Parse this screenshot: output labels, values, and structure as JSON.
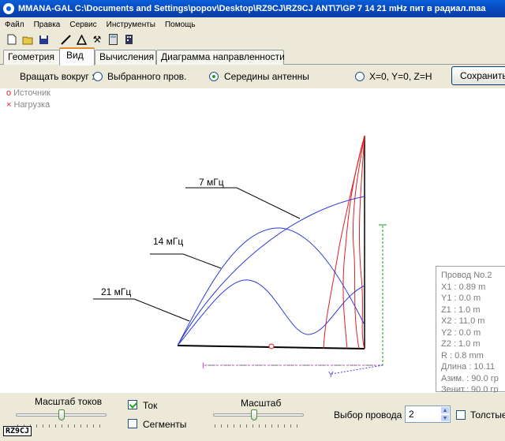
{
  "window": {
    "title": "MMANA-GAL C:\\Documents and Settings\\popov\\Desktop\\RZ9CJ\\RZ9CJ ANT\\7\\GP  7  14  21  mHz  пит в радиал.maa"
  },
  "menu": [
    "Файл",
    "Правка",
    "Сервис",
    "Инструменты",
    "Помощь"
  ],
  "toolbar": {
    "icons": [
      "new-file-icon",
      "open-folder-icon",
      "save-disk-icon",
      "line-tool-icon",
      "triangle-tool-icon",
      "tools-icon",
      "calculator-icon",
      "building-icon"
    ]
  },
  "tabs": [
    {
      "label": "Геометрия",
      "active": false
    },
    {
      "label": "Вид",
      "active": true
    },
    {
      "label": "Вычисления",
      "active": false
    },
    {
      "label": "Диаграмма направленности",
      "active": false
    }
  ],
  "rotate": {
    "label": "Вращать вокруг :",
    "options": [
      {
        "label": "Выбранного пров.",
        "selected": false
      },
      {
        "label": "Середины антенны",
        "selected": true
      },
      {
        "label": "X=0, Y=0, Z=H",
        "selected": false
      }
    ],
    "save_label": "Сохранить"
  },
  "legend": {
    "source": "Источник",
    "load": "Нагрузка",
    "source_marker": "o",
    "load_marker": "×"
  },
  "plot": {
    "labels": [
      "7 мГц",
      "14 мГц",
      "21 мГц"
    ],
    "colors": {
      "current": "#2a3ad8",
      "wire": "#000000",
      "vertical": "#e02020",
      "axis_x": "#e040e0",
      "axis_y": "#1a9a1a",
      "axis_z": "#4a4ae0"
    },
    "axis_markers": [
      "I",
      "Y"
    ]
  },
  "wire_info": {
    "title": "Провод No.2",
    "rows": [
      "X1   :  0.89 m",
      "Y1   :  0.0 m",
      "Z1   :  1.0 m",
      "X2   :  11.0 m",
      "Y2   :  0.0 m",
      "Z2   :  1.0 m",
      "R    :  0.8 mm",
      "Длина  :  10.11",
      "Азим.  :  90.0 гр",
      "Зенит.:  90.0 гр"
    ]
  },
  "bottom": {
    "current_scale_label": "Масштаб токов",
    "current_scale_level": 0.5,
    "scale_label": "Масштаб",
    "scale_level": 0.45,
    "current_checkbox": {
      "label": "Ток",
      "checked": true
    },
    "segments_checkbox": {
      "label": "Сегменты",
      "checked": false
    },
    "wire_select_label": "Выбор провода",
    "wire_select_value": "2",
    "thick_checkbox": {
      "label": "Толстые",
      "checked": false
    },
    "badge": "RZ9CJ"
  }
}
